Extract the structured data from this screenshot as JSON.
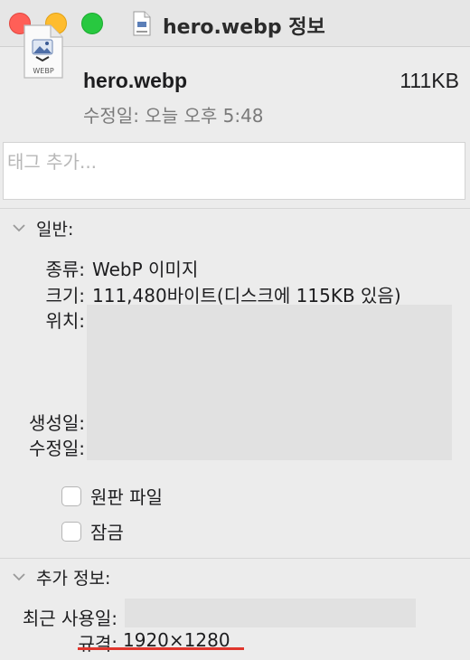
{
  "window": {
    "title": "hero.webp 정보",
    "traffic_lights": [
      "close",
      "minimize",
      "maximize"
    ],
    "colors": {
      "close": "#ff5f57",
      "minimize": "#febc2e",
      "maximize": "#28c840"
    }
  },
  "file": {
    "name": "hero.webp",
    "size": "111KB",
    "modified": "수정일: 오늘 오후 5:48",
    "icon_badge": "WEBP",
    "icon": "webp-document-icon"
  },
  "tags": {
    "placeholder": "태그 추가..."
  },
  "general": {
    "header": "일반:",
    "kind_label": "종류:",
    "kind_value": "WebP 이미지",
    "size_label": "크기:",
    "size_value": "111,480바이트(디스크에 115KB 있음)",
    "where_label": "위치:",
    "created_label": "생성일:",
    "modified_label": "수정일:",
    "stationery_label": "원판 파일",
    "locked_label": "잠금"
  },
  "more_info": {
    "header": "추가 정보:",
    "last_opened_label": "최근 사용일:",
    "dimensions_label": "규격:",
    "dimensions_value": "1920×1280",
    "highlight_color": "#e0362d"
  }
}
